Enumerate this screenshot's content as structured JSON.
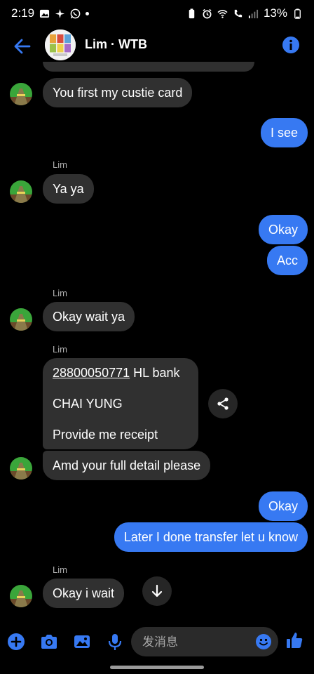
{
  "status_bar": {
    "time": "2:19",
    "battery": "13%"
  },
  "header": {
    "title": "Lim · WTB"
  },
  "messages": [
    {
      "side": "in",
      "text": "You first my custie card"
    },
    {
      "side": "out",
      "text": "I see"
    },
    {
      "side": "in",
      "sender": "Lim",
      "text": "Ya ya"
    },
    {
      "side": "out",
      "text": "Okay"
    },
    {
      "side": "out",
      "text": "Acc"
    },
    {
      "side": "in",
      "sender": "Lim",
      "text": "Okay wait ya"
    },
    {
      "side": "in",
      "sender": "Lim",
      "account_number": "28800050771",
      "bank": " HL bank",
      "name": "CHAI YUNG",
      "request": "Provide me receipt"
    },
    {
      "side": "in",
      "text": "Amd your full detail please"
    },
    {
      "side": "out",
      "text": "Okay"
    },
    {
      "side": "out",
      "text": "Later I done transfer let u know"
    },
    {
      "side": "in",
      "sender": "Lim",
      "text": "Okay i wait"
    }
  ],
  "composer": {
    "placeholder": "发消息"
  },
  "colors": {
    "accent": "#3779f2",
    "incoming_bubble": "#303030",
    "background": "#000000"
  },
  "icons": {
    "back": "arrow-left-icon",
    "info": "info-icon",
    "share": "share-icon",
    "scroll_down": "arrow-down-icon",
    "add": "plus-circle-icon",
    "camera": "camera-icon",
    "gallery": "image-icon",
    "mic": "microphone-icon",
    "emoji": "emoji-icon",
    "like": "thumbs-up-icon"
  }
}
